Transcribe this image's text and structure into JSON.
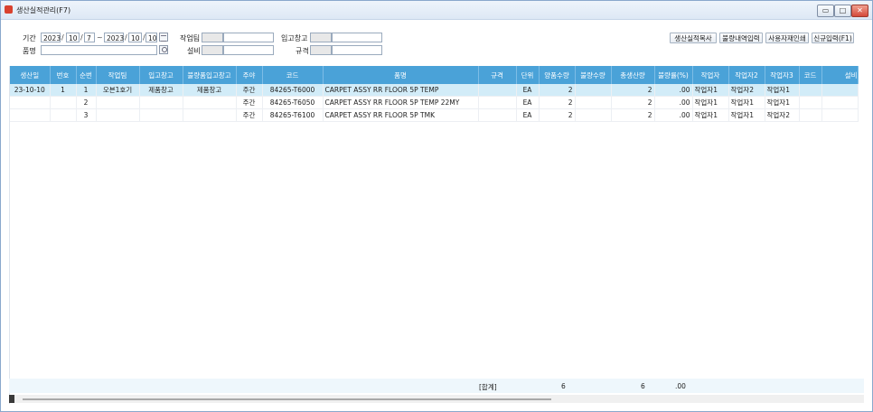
{
  "window": {
    "title": "생산실적관리(F7)"
  },
  "filters": {
    "period_label": "기간",
    "from": {
      "year": "2023",
      "month": "10",
      "day": "7"
    },
    "to": {
      "year": "2023",
      "month": "10",
      "day": "10"
    },
    "product_label": "품명",
    "team_label": "작업팀",
    "equipment_label": "설비",
    "warehouse_in_label": "입고창고",
    "spec_label": "규격"
  },
  "toolbar": {
    "copy_label": "생산실적복사",
    "defect_label": "불량내역입력",
    "material_label": "사용자재인쇄",
    "new_label": "신규입력(F1)"
  },
  "table": {
    "columns": [
      "생산일",
      "번호",
      "순번",
      "작업팀",
      "입고창고",
      "불량품입고창고",
      "주야",
      "코드",
      "품명",
      "규격",
      "단위",
      "양품수량",
      "불량수량",
      "총생산량",
      "불량률(%)",
      "작업자",
      "작업자2",
      "작업자3",
      "코드",
      "설비"
    ],
    "rows": [
      [
        "23-10-10",
        "1",
        "1",
        "오븐1호기",
        "제품창고",
        "제품창고",
        "주간",
        "84265-T6000",
        "CARPET ASSY RR FLOOR 5P TEMP",
        "",
        "EA",
        "2",
        "",
        "2",
        ".00",
        "작업자1",
        "작업자2",
        "작업자1",
        "",
        ""
      ],
      [
        "",
        "",
        "2",
        "",
        "",
        "",
        "주간",
        "84265-T6050",
        "CARPET ASSY RR FLOOR 5P TEMP 22MY",
        "",
        "EA",
        "2",
        "",
        "2",
        ".00",
        "작업자1",
        "작업자1",
        "작업자1",
        "",
        ""
      ],
      [
        "",
        "",
        "3",
        "",
        "",
        "",
        "주간",
        "84265-T6100",
        "CARPET ASSY RR FLOOR 5P TMK",
        "",
        "EA",
        "2",
        "",
        "2",
        ".00",
        "작업자1",
        "작업자1",
        "작업자2",
        "",
        ""
      ]
    ]
  },
  "summary": {
    "label": "[합계]",
    "good": "6",
    "total": "6",
    "rate": ".00"
  }
}
